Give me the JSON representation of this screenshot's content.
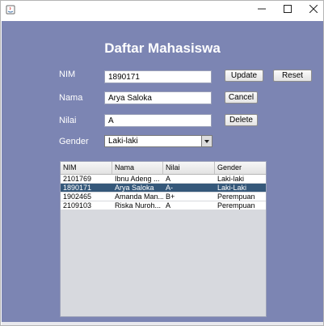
{
  "window": {
    "icons": [
      "java-cup-icon",
      "minimize-icon",
      "maximize-icon",
      "close-icon"
    ]
  },
  "form": {
    "title": "Daftar Mahasiswa",
    "nim": {
      "label": "NIM",
      "value": "1890171"
    },
    "nama": {
      "label": "Nama",
      "value": "Arya Saloka"
    },
    "nilai": {
      "label": "Nilai",
      "value": "A"
    },
    "gender": {
      "label": "Gender",
      "selected": "Laki-laki"
    }
  },
  "buttons": {
    "update": "Update",
    "reset": "Reset",
    "cancel": "Cancel",
    "delete": "Delete"
  },
  "table": {
    "columns": [
      "NIM",
      "Nama",
      "Nilai",
      "Gender"
    ],
    "rows": [
      {
        "nim": "2101769",
        "nama": "Ibnu Adeng ...",
        "nilai": "A",
        "gender": "Laki-laki",
        "selected": false
      },
      {
        "nim": "1890171",
        "nama": "Arya Saloka",
        "nilai": "A-",
        "gender": "Laki-Laki",
        "selected": true
      },
      {
        "nim": "1902465",
        "nama": "Amanda Man...",
        "nilai": "B+",
        "gender": "Perempuan",
        "selected": false
      },
      {
        "nim": "2109103",
        "nama": "Riska Nuroh...",
        "nilai": "A",
        "gender": "Perempuan",
        "selected": false
      }
    ]
  },
  "colors": {
    "panel_background": "#7c85b3",
    "selection": "#35587a"
  }
}
